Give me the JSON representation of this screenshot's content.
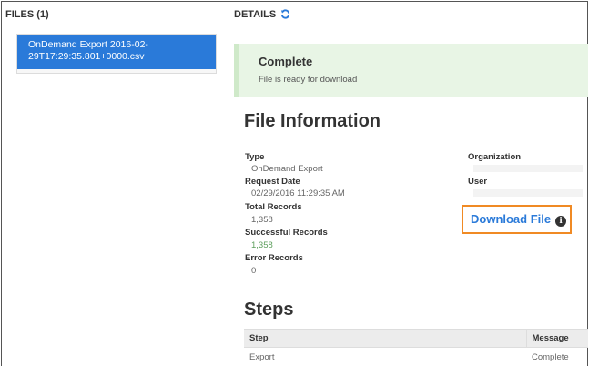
{
  "files": {
    "header": "FILES (1)",
    "items": [
      {
        "line1": "OnDemand Export 2016-02-",
        "line2": "29T17:29:35.801+0000.csv"
      }
    ]
  },
  "details": {
    "header": "DETAILS",
    "refresh_icon": "refresh-icon",
    "alert": {
      "title": "Complete",
      "text": "File is ready for download"
    },
    "file_info_title": "File Information",
    "fields": {
      "type": {
        "label": "Type",
        "value": "OnDemand Export"
      },
      "request_date": {
        "label": "Request Date",
        "value": "02/29/2016 11:29:35 AM"
      },
      "total_records": {
        "label": "Total Records",
        "value": "1,358"
      },
      "successful_records": {
        "label": "Successful Records",
        "value": "1,358"
      },
      "error_records": {
        "label": "Error Records",
        "value": "0"
      },
      "organization": {
        "label": "Organization"
      },
      "user": {
        "label": "User"
      }
    },
    "download": {
      "label": "Download File",
      "icon": "info-icon"
    },
    "steps_title": "Steps",
    "steps": {
      "columns": [
        "Step",
        "Message"
      ],
      "rows": [
        {
          "step": "Export",
          "message": "Complete"
        }
      ]
    }
  },
  "colors": {
    "selected_file_bg": "#2a7ad9",
    "alert_bg": "#e8f5e5",
    "download_border": "#f08a24",
    "link_blue": "#2a7ad9"
  }
}
